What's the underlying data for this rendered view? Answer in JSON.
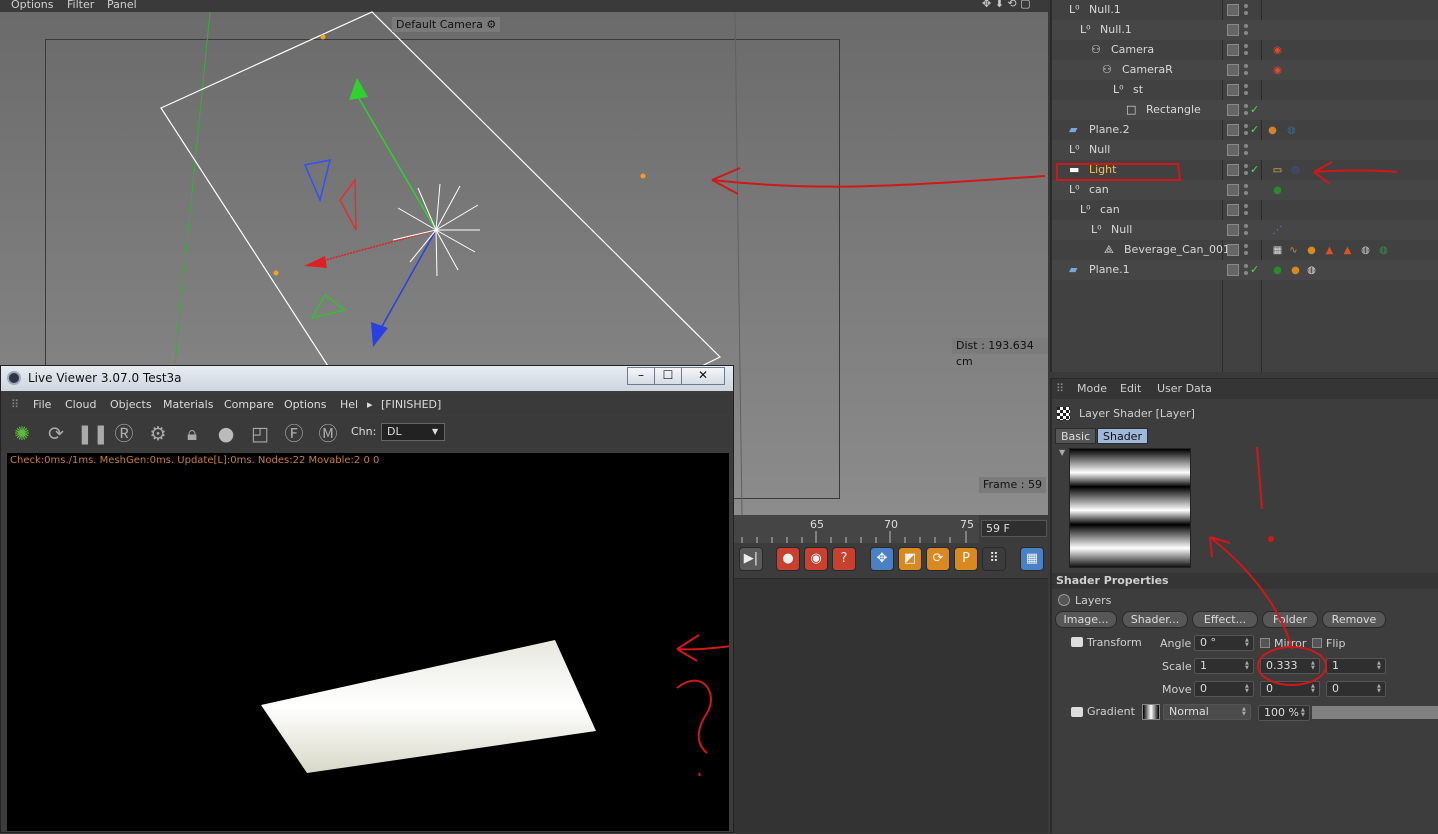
{
  "viewport": {
    "menu": [
      "Options",
      "Filter",
      "Panel"
    ],
    "camera_label": "Default Camera",
    "distance": "Dist : 193.634 cm",
    "frame": "Frame : 59"
  },
  "timeline": {
    "ticks": [
      "65",
      "70",
      "75"
    ],
    "current_frame": "59 F"
  },
  "object_manager": {
    "objects": [
      {
        "name": "Null.1",
        "icon": "null-icon",
        "indent": 20
      },
      {
        "name": "Null.1",
        "icon": "null-icon",
        "indent": 31
      },
      {
        "name": "Camera",
        "icon": "camera-icon",
        "indent": 42
      },
      {
        "name": "CameraR",
        "icon": "camera-icon",
        "indent": 53
      },
      {
        "name": "st",
        "icon": "null-icon",
        "indent": 64
      },
      {
        "name": "Rectangle",
        "icon": "spline-rectangle-icon",
        "indent": 77
      },
      {
        "name": "Plane.2",
        "icon": "plane-icon",
        "indent": 20
      },
      {
        "name": "Null",
        "icon": "null-icon",
        "indent": 20
      },
      {
        "name": "Light",
        "icon": "area-light-icon",
        "indent": 20
      },
      {
        "name": "can",
        "icon": "null-icon",
        "indent": 20
      },
      {
        "name": "can",
        "icon": "null-icon",
        "indent": 31
      },
      {
        "name": "Null",
        "icon": "null-icon",
        "indent": 42
      },
      {
        "name": "Beverage_Can_001",
        "icon": "polygon-object-icon",
        "indent": 55
      },
      {
        "name": "Plane.1",
        "icon": "plane-icon",
        "indent": 20
      }
    ]
  },
  "attribute_manager": {
    "menu": [
      "Mode",
      "Edit",
      "User Data"
    ],
    "title": "Layer Shader [Layer]",
    "tabs": [
      "Basic",
      "Shader"
    ],
    "section": "Shader Properties",
    "layers_label": "Layers",
    "buttons": [
      "Image...",
      "Shader...",
      "Effect...",
      "Folder",
      "Remove"
    ],
    "transform": {
      "label": "Transform",
      "angle_label": "Angle",
      "angle": "0 °",
      "mirror": "Mirror",
      "flip": "Flip",
      "scale_label": "Scale",
      "scale": [
        "1",
        "0.333",
        "1"
      ],
      "move_label": "Move",
      "move": [
        "0",
        "0",
        "0"
      ]
    },
    "gradient": {
      "label": "Gradient",
      "mode": "Normal",
      "opacity": "100 %"
    }
  },
  "live_viewer": {
    "title": "Live Viewer 3.07.0 Test3a",
    "window_buttons": [
      "–",
      "☐",
      "✕"
    ],
    "menu": [
      "File",
      "Cloud",
      "Objects",
      "Materials",
      "Compare",
      "Options",
      "Hel",
      "[FINISHED]"
    ],
    "channel_label": "Chn:",
    "channel_value": "DL",
    "status": "Check:0ms./1ms. MeshGen:0ms. Update[L]:0ms. Nodes:22 Movable:2  0 0"
  },
  "colors": {
    "selected_object": "#f4c048",
    "annotation_red": "#d01818",
    "status_text": "#c77d2d"
  }
}
